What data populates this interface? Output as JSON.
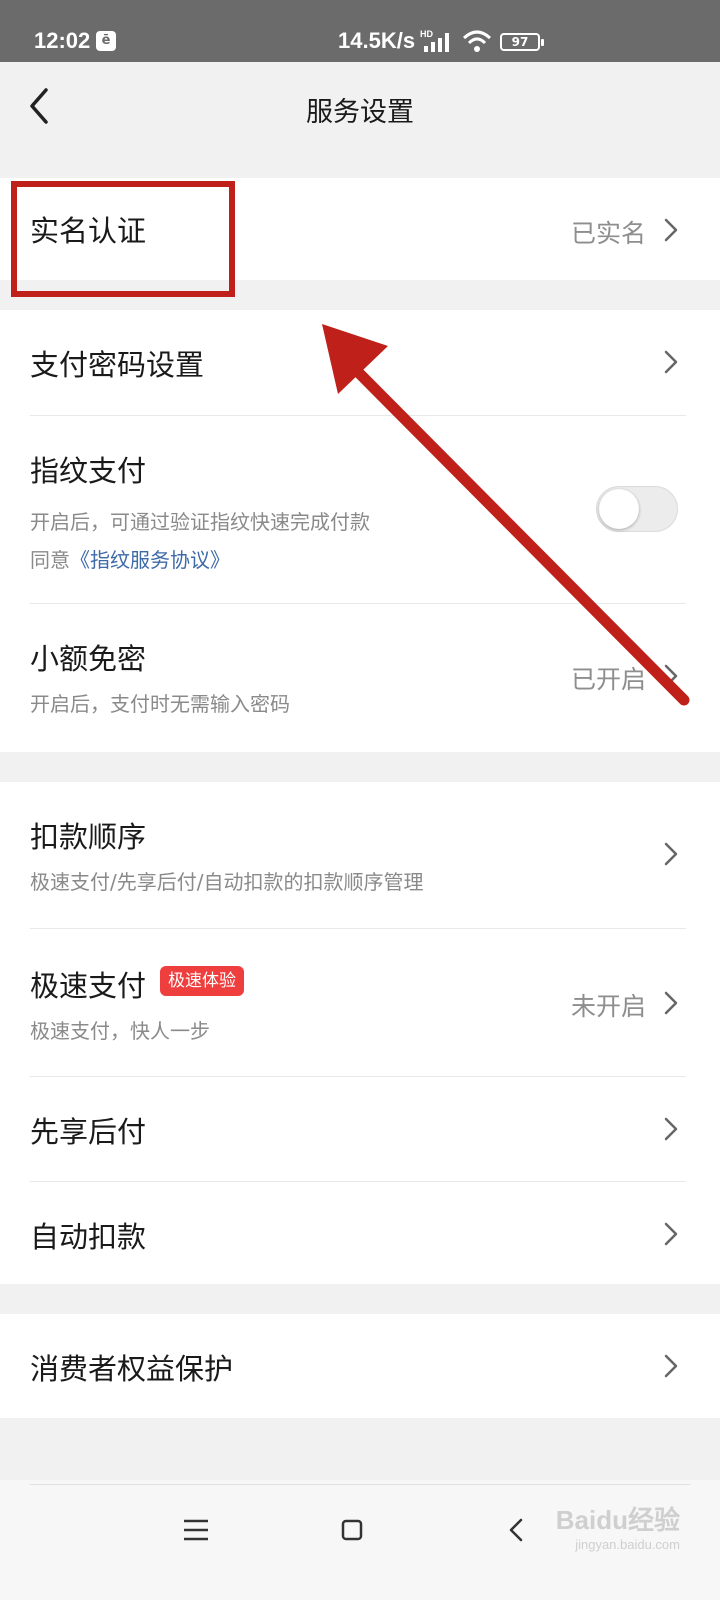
{
  "status_bar": {
    "time": "12:02",
    "notif_glyph": "ē",
    "net_speed": "14.5K/s",
    "battery": "97"
  },
  "header": {
    "title": "服务设置"
  },
  "groups": {
    "real_name": {
      "label": "实名认证",
      "value": "已实名"
    },
    "payment": {
      "password": {
        "label": "支付密码设置"
      },
      "fingerprint": {
        "label": "指纹支付",
        "sub": "开启后，可通过验证指纹快速完成付款",
        "agree_prefix": "同意",
        "agree_link": "《指纹服务协议》",
        "enabled": false
      },
      "small_free": {
        "label": "小额免密",
        "sub": "开启后，支付时无需输入密码",
        "value": "已开启"
      }
    },
    "deduction": {
      "order": {
        "label": "扣款顺序",
        "sub": "极速支付/先享后付/自动扣款的扣款顺序管理"
      },
      "fast_pay": {
        "label": "极速支付",
        "badge": "极速体验",
        "sub": "极速支付，快人一步",
        "value": "未开启"
      },
      "pay_later": {
        "label": "先享后付"
      },
      "auto_deduct": {
        "label": "自动扣款"
      }
    },
    "consumer": {
      "label": "消费者权益保护"
    }
  },
  "watermark": {
    "main": "Baidu经验",
    "sub": "jingyan.baidu.com"
  },
  "colors": {
    "annotation_red": "#c0201a",
    "badge_red": "#ee3e3e",
    "link_blue": "#3d6aa8"
  },
  "icons": [
    "back-icon",
    "chevron-right-icon",
    "menu-icon",
    "home-icon",
    "back-nav-icon",
    "signal-icon",
    "wifi-icon",
    "battery-icon"
  ]
}
